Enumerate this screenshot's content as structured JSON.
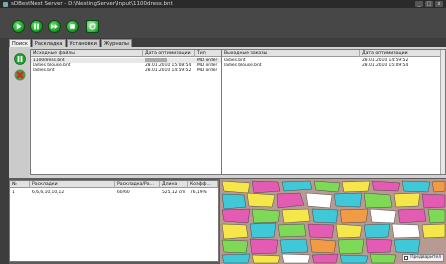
{
  "window": {
    "title": "sDBestNest Server - D:\\NestingServer\\Input\\1100dress.bnt",
    "controls": [
      "_",
      "□",
      "x"
    ]
  },
  "toolbar": {
    "buttons": [
      "play-icon",
      "pause-icon",
      "fast-forward-icon",
      "stop-icon",
      "refresh-icon"
    ]
  },
  "tabs": [
    "Поиск",
    "Раскладка",
    "Установки",
    "Журналы"
  ],
  "input_files": {
    "columns": [
      "Исходные файлы",
      "Дата оптимизации",
      "Тип"
    ],
    "rows": [
      {
        "name": "1100dress.bnt",
        "date": "",
        "type": "MD order"
      },
      {
        "name": "ladies blouse.bnt",
        "date": "28.01.2010 15:08:54",
        "type": "MD order"
      },
      {
        "name": "ladies.bnt",
        "date": "28.01.2010 14:59:52",
        "type": "MD order"
      }
    ]
  },
  "output_orders": {
    "columns": [
      "Выходные заказы",
      "Дата оптимизации"
    ],
    "rows": [
      {
        "name": "ladies.bnt",
        "date": "28.01.2010 14:59:52"
      },
      {
        "name": "ladies blouse.bnt",
        "date": "28.01.2010 15:09:54"
      }
    ]
  },
  "layouts": {
    "columns": [
      "№",
      "Раскладки",
      "Раскладка/Ра...",
      "Длина",
      "Коэфф..."
    ],
    "rows": [
      {
        "no": "1",
        "layout": "6,6,6,10,10,12",
        "ratio": "60/60",
        "length": "525,12 cm",
        "coef": "76,19%"
      }
    ]
  },
  "preview": {
    "checkbox_label": "Предварител"
  },
  "colors": {
    "accent_green": "#1fa32a",
    "panel_bg": "#d2d2d2",
    "preview_bg": "#b79a92"
  }
}
